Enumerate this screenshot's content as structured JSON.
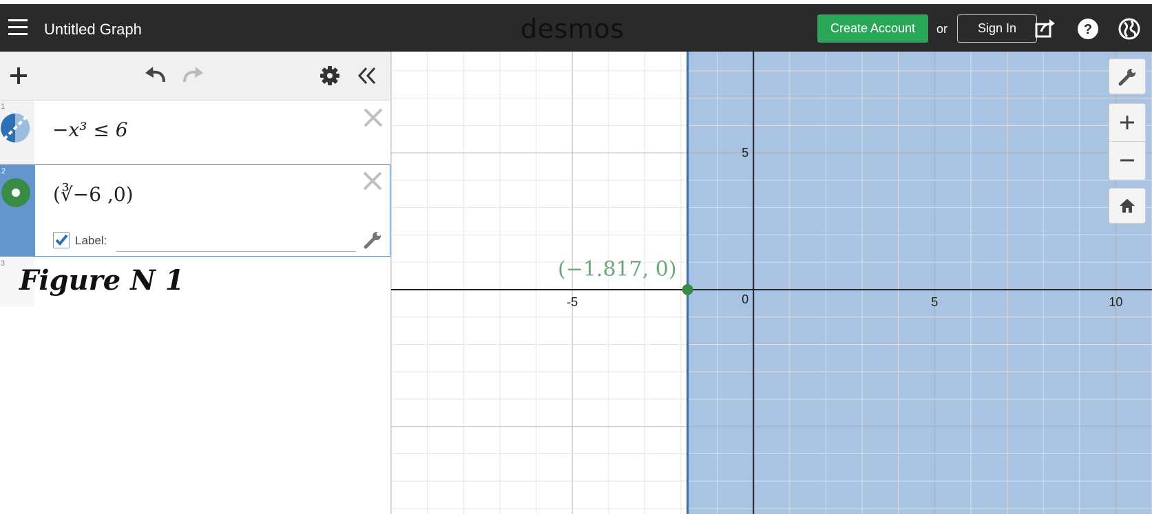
{
  "header": {
    "title": "Untitled Graph",
    "logo": "desmos",
    "create_account": "Create Account",
    "or": "or",
    "sign_in": "Sign In",
    "icons": [
      "menu-icon",
      "share-icon",
      "help-icon",
      "globe-icon"
    ]
  },
  "toolbar": {
    "icons": [
      "plus-icon",
      "undo-icon",
      "redo-icon",
      "gear-icon",
      "collapse-icon"
    ]
  },
  "expressions": [
    {
      "num": "1",
      "latex": "−x³ ≤ 6",
      "color": "#2d70b3"
    },
    {
      "num": "2",
      "latex": "(∛−6 ,0)",
      "color": "#388c46",
      "label_text": "Label:",
      "label_value": "",
      "label_checked": true
    },
    {
      "num": "3",
      "text": "Figure N 1"
    }
  ],
  "graph": {
    "x_ticks": [
      "-5",
      "0",
      "5",
      "10"
    ],
    "y_ticks": [
      "5"
    ],
    "point_label": "(−1.817, 0)",
    "shade_color": "#a9c4e2",
    "boundary_color": "#2d70b3",
    "point_color": "#388c46"
  },
  "chart_data": {
    "type": "scatter",
    "title": "",
    "xlabel": "",
    "ylabel": "",
    "xlim": [
      -10,
      11
    ],
    "ylim": [
      -8.2,
      8.7
    ],
    "grid": true,
    "region": {
      "inequality": "x ≥ -1.817",
      "color": "#a9c4e2"
    },
    "series": [
      {
        "x": [
          -1.817
        ],
        "y": [
          0
        ],
        "point_label": "(−1.817, 0)",
        "color": "#388c46"
      }
    ]
  }
}
